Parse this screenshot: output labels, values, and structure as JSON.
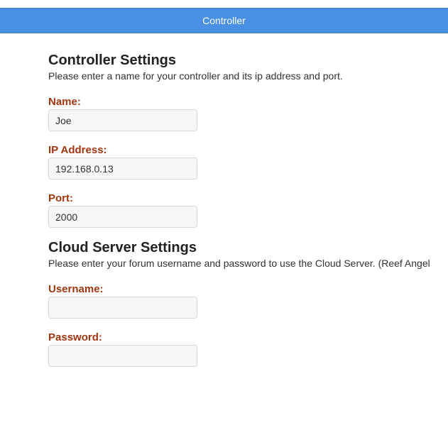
{
  "header": {
    "title": "Controller"
  },
  "controller_settings": {
    "title": "Controller Settings",
    "description": "Please enter a name for your controller and its ip address and port.",
    "name_label": "Name:",
    "name_value": "Joe",
    "ip_label": "IP Address:",
    "ip_value": "192.168.0.13",
    "port_label": "Port:",
    "port_value": "2000"
  },
  "cloud_settings": {
    "title": "Cloud Server Settings",
    "description": "Please enter your forum username and password to use the Cloud Server. (Reef Angel",
    "username_label": "Username:",
    "username_value": "",
    "password_label": "Password:",
    "password_value": ""
  },
  "colors": {
    "header_bg": "#4a90e2",
    "label": "#a0360f"
  }
}
